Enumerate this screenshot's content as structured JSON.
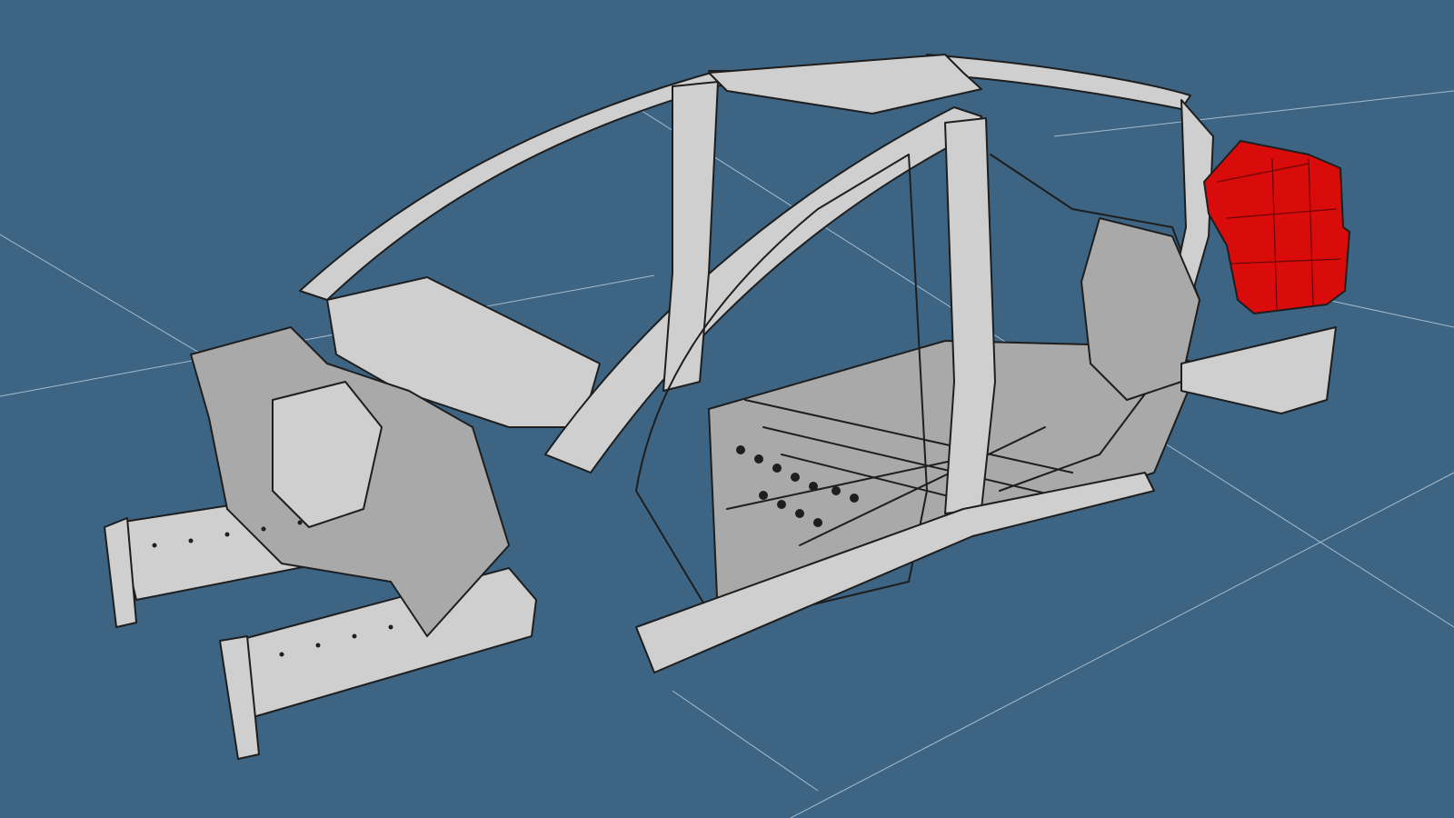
{
  "viewport": {
    "background": "#3d6483",
    "grid_line_color": "#c9d8e4"
  },
  "model": {
    "name": "car-body-in-white",
    "body_color": "#cfcfcf",
    "body_shade_color": "#a9a9a9",
    "outline_color": "#1e1e1e",
    "highlighted_part": {
      "name": "rear-quarter-panel",
      "color": "#d90b0b"
    }
  }
}
